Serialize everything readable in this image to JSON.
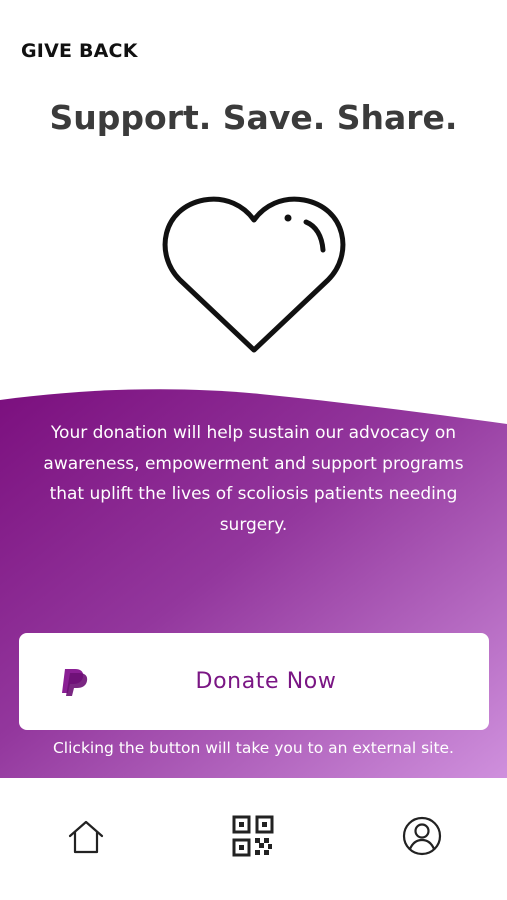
{
  "header": {
    "title": "GIVE BACK"
  },
  "hero": {
    "headline": "Support. Save. Share.",
    "icon": "heart-icon"
  },
  "donation": {
    "message": "Your donation will help sustain our advocacy on awareness, empowerment and support programs that uplift the lives of scoliosis patients needing surgery.",
    "button_label": "Donate Now",
    "button_icon": "paypal-icon",
    "footnote": "Clicking the button will take you to an external site."
  },
  "tabbar": {
    "items": [
      {
        "icon": "home-icon"
      },
      {
        "icon": "qr-code-icon"
      },
      {
        "icon": "profile-icon"
      }
    ]
  },
  "colors": {
    "accent": "#7a1684",
    "gradient_start": "#7b0f7e",
    "gradient_end": "#c98ad8",
    "headline": "#3b3b3b"
  }
}
